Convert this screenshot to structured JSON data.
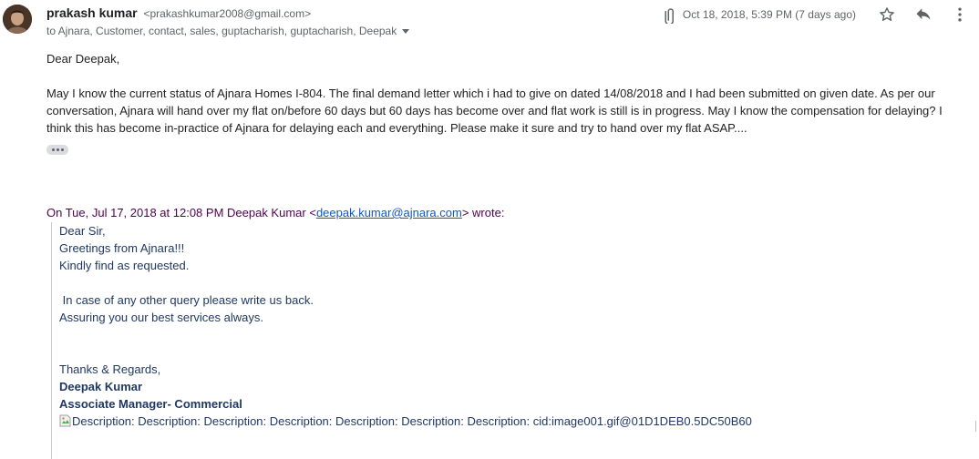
{
  "sender": {
    "name": "prakash kumar",
    "email": "<prakashkumar2008@gmail.com>",
    "to_line": "to Ajnara, Customer, contact, sales, guptacharish, guptacharish, Deepak"
  },
  "header": {
    "date": "Oct 18, 2018, 5:39 PM (7 days ago)",
    "icons": [
      "attachment-icon",
      "star-icon",
      "reply-icon",
      "more-vert-icon"
    ]
  },
  "message": {
    "greeting": "Dear Deepak,",
    "paragraph_line1": "May I know the current status of Ajnara Homes I-804. The final demand letter which i had to give on dated 14/08/2018 and I had been submitted on given date. As per our",
    "paragraph_line2": "conversation, Ajnara will hand over my flat on/before 60 days but 60 days has become over and flat work is still is in progress. May I know the compensation for delaying? I",
    "paragraph_line3": "think this  has become in-practice of Ajnara for delaying each and everything.  Please make it sure and try to hand over my flat ASAP...."
  },
  "quoted": {
    "intro_prefix": "On Tue, Jul 17, 2018 at 12:08 PM Deepak Kumar <",
    "intro_email": "deepak.kumar@ajnara.com",
    "intro_suffix": "> wrote:",
    "lines": {
      "l1": "Dear Sir,",
      "l2": "Greetings from Ajnara!!!",
      "l3": "Kindly find as requested.",
      "l4": " In case of any other query please write us back.",
      "l5": "Assuring you our best services always.",
      "l6": "Thanks & Regards,",
      "l7": "Deepak Kumar",
      "l8": "Associate Manager- Commercial",
      "l9": "Description: Description: Description: Description: Description: Description: Description: cid:image001.gif@01D1DEB0.5DC50B60"
    }
  },
  "colors": {
    "quote_text": "#1f3864",
    "quote_intro": "#500050",
    "link": "#1155cc"
  }
}
